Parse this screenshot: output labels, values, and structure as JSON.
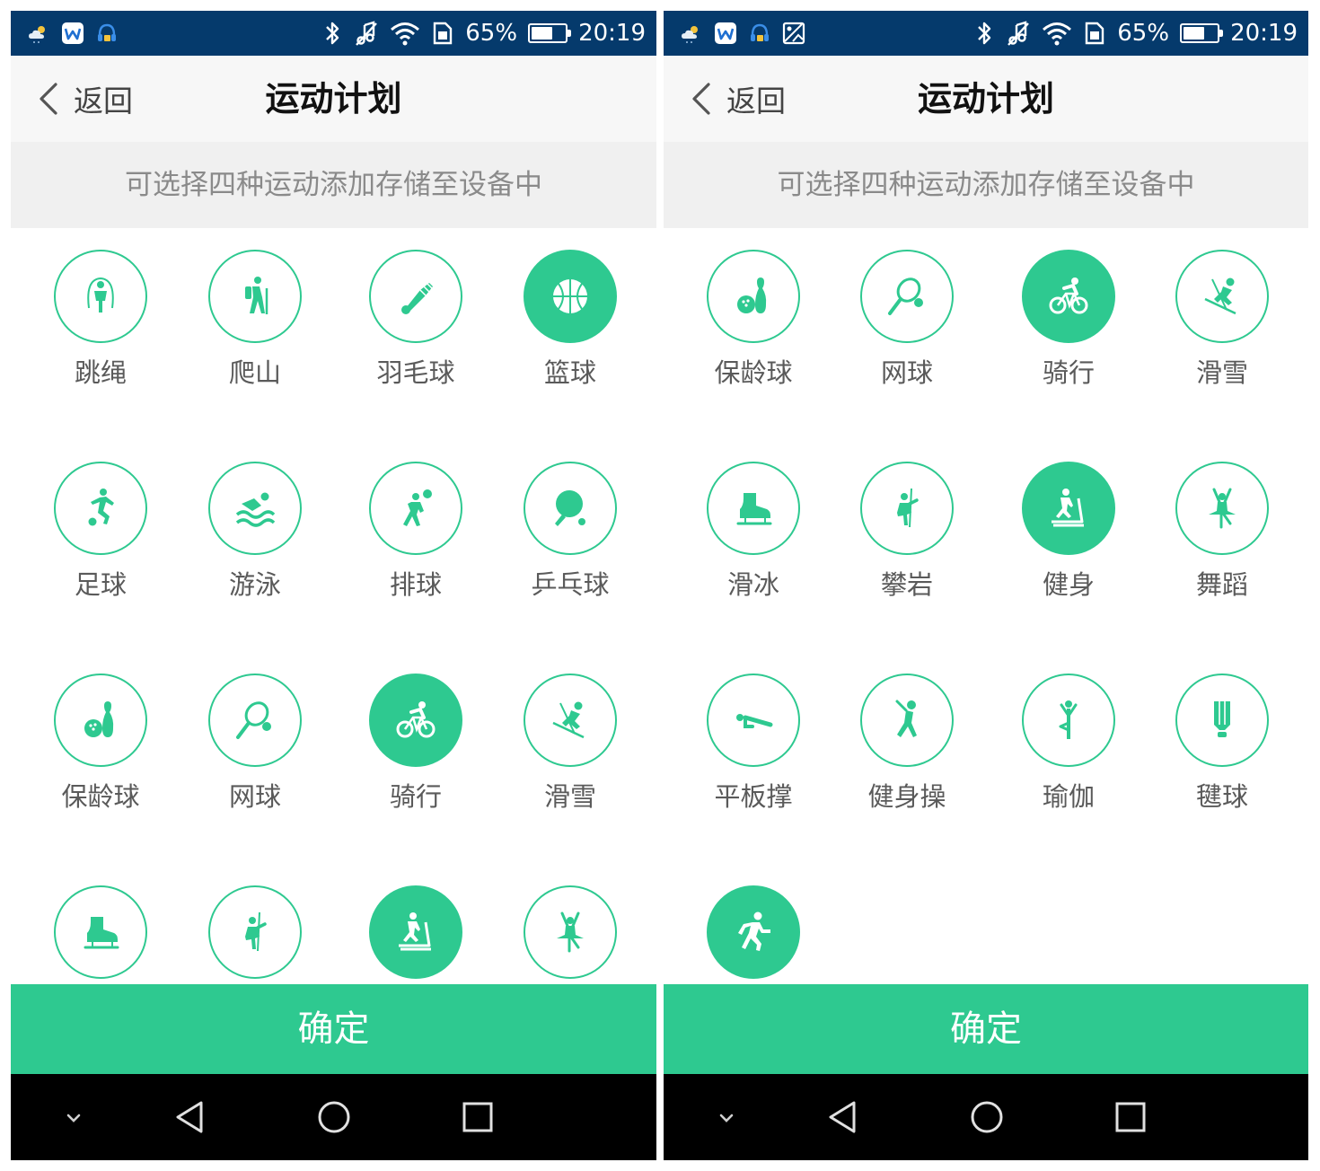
{
  "status_bar": {
    "battery": "65%",
    "battery_level": 0.65,
    "time": "20:19"
  },
  "nav": {
    "back_label": "返回",
    "title": "运动计划"
  },
  "hint": "可选择四种运动添加存储至设备中",
  "confirm_label": "确定",
  "colors": {
    "accent": "#2ec990",
    "status_bar": "#053a6c",
    "nav_bar": "#000000"
  },
  "left_screen": {
    "sports": [
      {
        "label": "跳绳",
        "icon": "jump-rope-icon",
        "selected": false
      },
      {
        "label": "爬山",
        "icon": "hiking-icon",
        "selected": false
      },
      {
        "label": "羽毛球",
        "icon": "badminton-icon",
        "selected": false
      },
      {
        "label": "篮球",
        "icon": "basketball-icon",
        "selected": true
      },
      {
        "label": "足球",
        "icon": "soccer-icon",
        "selected": false
      },
      {
        "label": "游泳",
        "icon": "swimming-icon",
        "selected": false
      },
      {
        "label": "排球",
        "icon": "volleyball-icon",
        "selected": false
      },
      {
        "label": "乒乓球",
        "icon": "table-tennis-icon",
        "selected": false
      },
      {
        "label": "保龄球",
        "icon": "bowling-icon",
        "selected": false
      },
      {
        "label": "网球",
        "icon": "tennis-icon",
        "selected": false
      },
      {
        "label": "骑行",
        "icon": "cycling-icon",
        "selected": true
      },
      {
        "label": "滑雪",
        "icon": "skiing-icon",
        "selected": false
      },
      {
        "label": "",
        "icon": "ice-skate-icon",
        "selected": false
      },
      {
        "label": "",
        "icon": "climbing-icon",
        "selected": false
      },
      {
        "label": "",
        "icon": "treadmill-icon",
        "selected": true
      },
      {
        "label": "",
        "icon": "dance-icon",
        "selected": false
      }
    ]
  },
  "right_screen": {
    "sports": [
      {
        "label": "保龄球",
        "icon": "bowling-icon",
        "selected": false
      },
      {
        "label": "网球",
        "icon": "tennis-icon",
        "selected": false
      },
      {
        "label": "骑行",
        "icon": "cycling-icon",
        "selected": true
      },
      {
        "label": "滑雪",
        "icon": "skiing-icon",
        "selected": false
      },
      {
        "label": "滑冰",
        "icon": "ice-skate-icon",
        "selected": false
      },
      {
        "label": "攀岩",
        "icon": "climbing-icon",
        "selected": false
      },
      {
        "label": "健身",
        "icon": "treadmill-icon",
        "selected": true
      },
      {
        "label": "舞蹈",
        "icon": "dance-icon",
        "selected": false
      },
      {
        "label": "平板撑",
        "icon": "plank-icon",
        "selected": false
      },
      {
        "label": "健身操",
        "icon": "aerobics-icon",
        "selected": false
      },
      {
        "label": "瑜伽",
        "icon": "yoga-icon",
        "selected": false
      },
      {
        "label": "毽球",
        "icon": "shuttlecock-kick-icon",
        "selected": false
      },
      {
        "label": "",
        "icon": "running-icon",
        "selected": true
      }
    ]
  }
}
